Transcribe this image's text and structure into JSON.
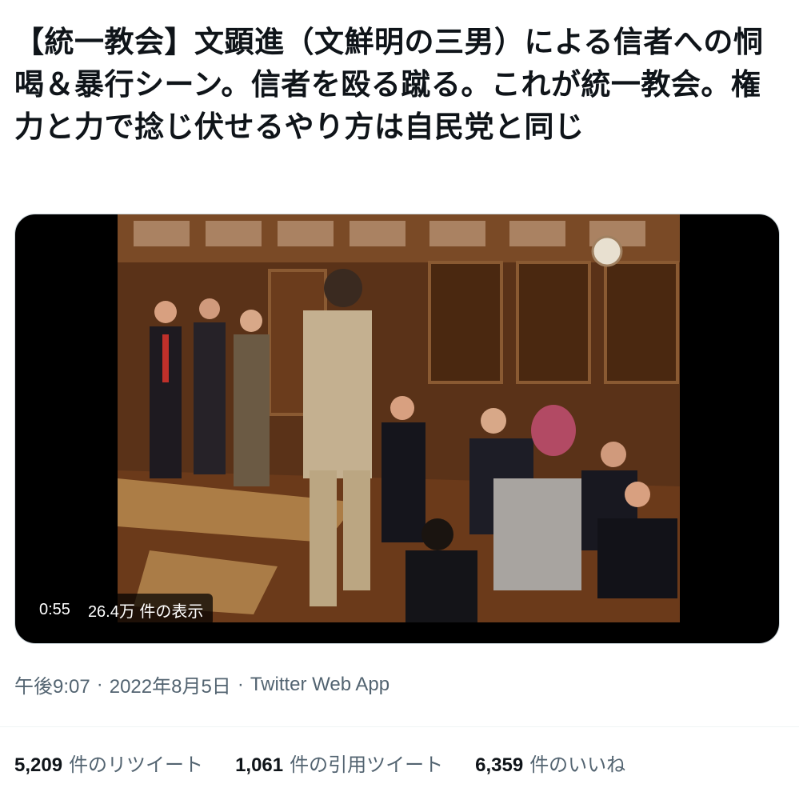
{
  "tweet": {
    "text": "【統一教会】文顕進（文鮮明の三男）による信者への恫喝＆暴行シーン。信者を殴る蹴る。これが統一教会。権力と力で捻じ伏せるやり方は自民党と同じ"
  },
  "video": {
    "duration": "0:55",
    "views": "26.4万 件の表示"
  },
  "meta": {
    "time": "午後9:07",
    "separator1": "·",
    "date": "2022年8月5日",
    "separator2": "·",
    "source": "Twitter Web App"
  },
  "stats": {
    "retweets_count": "5,209",
    "retweets_label": "件のリツイート",
    "quotes_count": "1,061",
    "quotes_label": "件の引用ツイート",
    "likes_count": "6,359",
    "likes_label": "件のいいね"
  }
}
